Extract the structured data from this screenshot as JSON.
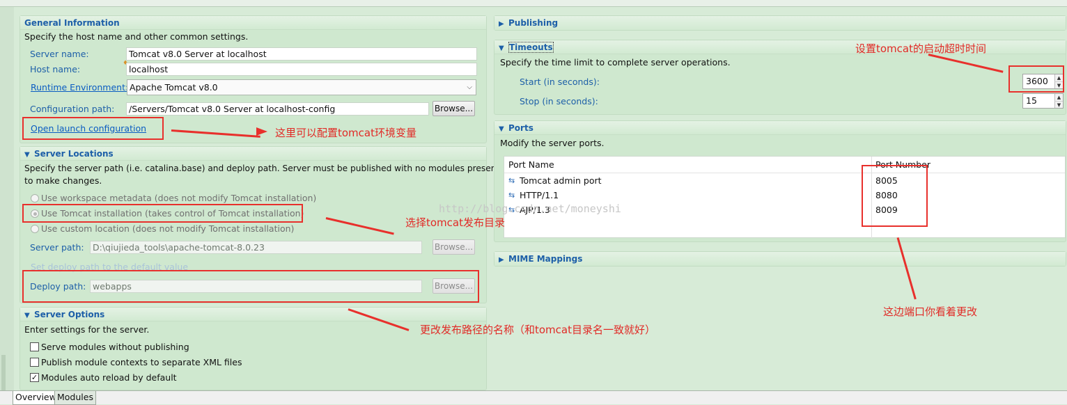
{
  "general": {
    "title": "General Information",
    "desc": "Specify the host name and other common settings.",
    "server_name_label": "Server name:",
    "server_name_value": "Tomcat v8.0 Server at localhost",
    "host_name_label": "Host name:",
    "host_name_value": "localhost",
    "runtime_label": "Runtime Environment:",
    "runtime_value": "Apache Tomcat v8.0",
    "config_path_label": "Configuration path:",
    "config_path_value": "/Servers/Tomcat v8.0 Server at localhost-config",
    "browse_label": "Browse...",
    "open_launch_label": "Open launch configuration"
  },
  "locations": {
    "title": "Server Locations",
    "desc_line1": "Specify the server path (i.e. catalina.base) and deploy path. Server must be published with no modules present",
    "desc_line2": "to make changes.",
    "radio_workspace": "Use workspace metadata (does not modify Tomcat installation)",
    "radio_tomcat": "Use Tomcat installation (takes control of Tomcat installation)",
    "radio_custom": "Use custom location (does not modify Tomcat installation)",
    "server_path_label": "Server path:",
    "server_path_value": "D:\\qiujieda_tools\\apache-tomcat-8.0.23",
    "browse_label": "Browse...",
    "set_default_label": "Set deploy path to the default value",
    "deploy_path_label": "Deploy path:",
    "deploy_path_value": "webapps",
    "deploy_browse_label": "Browse..."
  },
  "options": {
    "title": "Server Options",
    "desc": "Enter settings for the server.",
    "items": [
      {
        "label": "Serve modules without publishing",
        "checked": false,
        "mark": ""
      },
      {
        "label": "Publish module contexts to separate XML files",
        "checked": false,
        "mark": ""
      },
      {
        "label": "Modules auto reload by default",
        "checked": true,
        "mark": "✓"
      }
    ]
  },
  "publishing": {
    "title": "Publishing"
  },
  "timeouts": {
    "title": "Timeouts",
    "desc": "Specify the time limit to complete server operations.",
    "start_label": "Start (in seconds):",
    "start_value": "3600",
    "stop_label": "Stop (in seconds):",
    "stop_value": "15"
  },
  "ports": {
    "title": "Ports",
    "desc": "Modify the server ports.",
    "col_name": "Port Name",
    "col_number": "Port Number",
    "rows": [
      {
        "name": "Tomcat admin port",
        "number": "8005"
      },
      {
        "name": "HTTP/1.1",
        "number": "8080"
      },
      {
        "name": "AJP/1.3",
        "number": "8009"
      }
    ]
  },
  "mime": {
    "title": "MIME Mappings"
  },
  "annotations": {
    "env_vars": "这里可以配置tomcat环境变量",
    "select_dir": "选择tomcat发布目录",
    "deploy_name": "更改发布路径的名称（和tomcat目录名一致就好）",
    "timeout": "设置tomcat的启动超时时间",
    "ports": "这边端口你看着更改"
  },
  "watermark": "http://blog.csdn.net/moneyshi",
  "tabs": {
    "overview": "Overview",
    "modules": "Modules"
  },
  "colors": {
    "accent": "#1d5fa8",
    "annotation": "#e8302c",
    "background": "#d7ebd7"
  }
}
